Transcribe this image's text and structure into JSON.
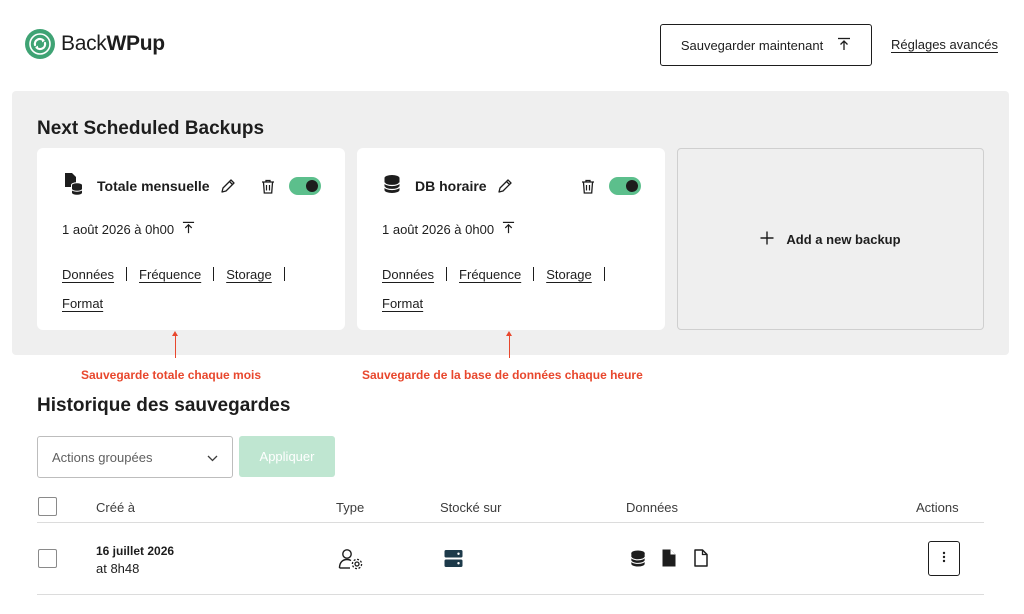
{
  "header": {
    "logo_light": "Back",
    "logo_bold": "WPup",
    "save_now_label": "Sauvegarder maintenant",
    "advanced_settings_label": "Réglages avancés"
  },
  "scheduled": {
    "title": "Next Scheduled Backups",
    "cards": [
      {
        "name": "Totale mensuelle",
        "icon": "file-database-icon",
        "enabled": true,
        "next_run": "1 août 2026 à 0h00",
        "links": [
          "Données",
          "Fréquence",
          "Storage",
          "Format"
        ]
      },
      {
        "name": "DB horaire",
        "icon": "database-icon",
        "enabled": true,
        "next_run": "1 août 2026 à 0h00",
        "links": [
          "Données",
          "Fréquence",
          "Storage",
          "Format"
        ]
      }
    ],
    "add_label": "Add a new backup"
  },
  "annotations": [
    "Sauvegarde totale chaque mois",
    "Sauvegarde de la base de données chaque heure"
  ],
  "history": {
    "title": "Historique des sauvegardes",
    "bulk_actions": {
      "selected": "Actions groupées"
    },
    "apply_label": "Appliquer",
    "columns": [
      "Créé à",
      "Type",
      "Stocké sur",
      "Données",
      "Actions"
    ],
    "rows": [
      {
        "date": "16 juillet 2026",
        "time": "at 8h48",
        "type_icon": "user-gear-icon",
        "storage_icon": "server-icon",
        "data_icons": [
          "database-icon",
          "file-filled-icon",
          "file-outline-icon"
        ]
      }
    ]
  },
  "colors": {
    "brand_green": "#3fa374",
    "toggle_on": "#5cbf8c",
    "annotation_red": "#e8472d",
    "panel_bg": "#efefef",
    "apply_disabled": "#bfe6d1"
  }
}
